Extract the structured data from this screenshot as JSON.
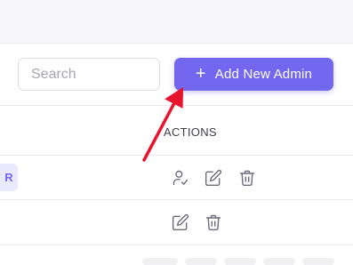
{
  "toolbar": {
    "search_placeholder": "Search",
    "add_button_label": "Add New Admin",
    "add_button_icon": "plus-icon"
  },
  "table": {
    "columns": [
      "ACTIONS"
    ],
    "rows": [
      {
        "badge": "R",
        "actions": [
          "user-check-icon",
          "edit-icon",
          "trash-icon"
        ]
      },
      {
        "badge": "",
        "actions": [
          "edit-icon",
          "trash-icon"
        ]
      }
    ]
  },
  "colors": {
    "accent": "#7367f0",
    "badge_bg": "#ebe9fd",
    "annotation_arrow": "#e8132d"
  }
}
